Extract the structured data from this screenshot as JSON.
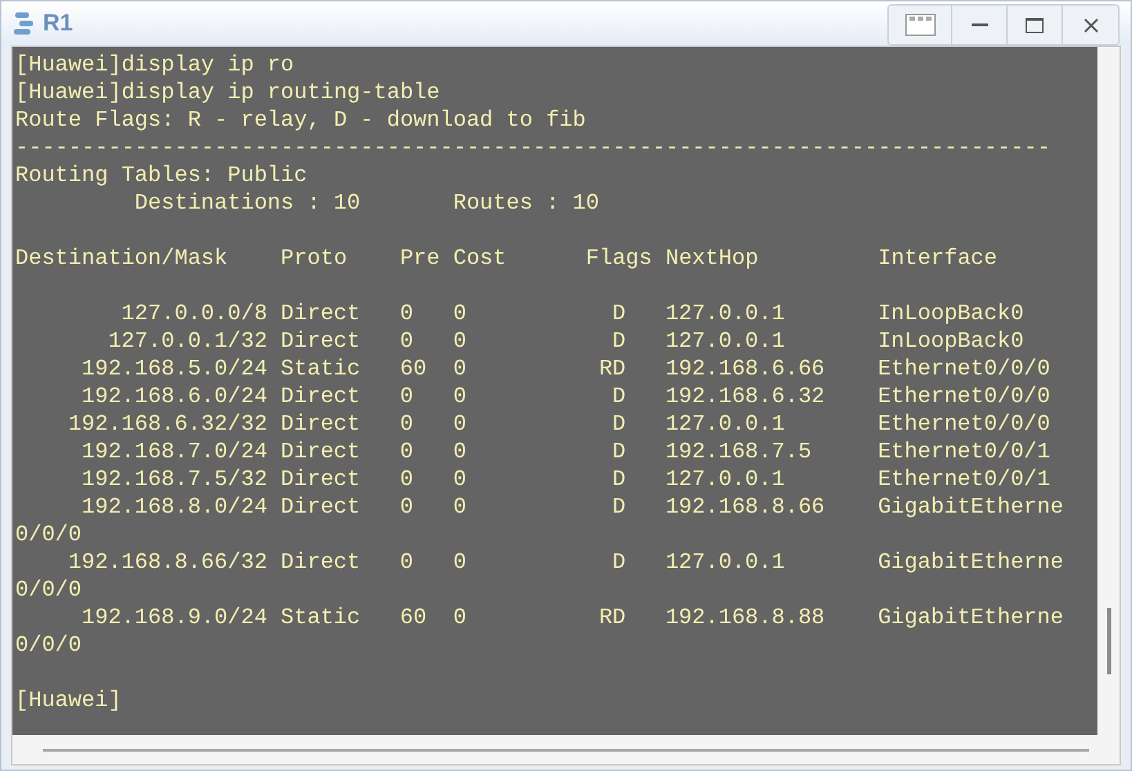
{
  "window": {
    "title": "R1"
  },
  "terminal": {
    "lines_before": [
      "[Huawei]display ip ro",
      "[Huawei]display ip routing-table",
      "Route Flags: R - relay, D - download to fib"
    ],
    "separator": "------------------------------------------------------------------------------",
    "table_title": "Routing Tables: Public",
    "summary": [
      "Destinations : 10",
      "Routes : 10"
    ],
    "columns": [
      "Destination/Mask",
      "Proto",
      "Pre",
      "Cost",
      "Flags",
      "NextHop",
      "Interface"
    ],
    "routes": [
      {
        "destination": "127.0.0.0/8",
        "proto": "Direct",
        "pre": "0",
        "cost": "0",
        "flags": "D",
        "nexthop": "127.0.0.1",
        "interface": "InLoopBack0"
      },
      {
        "destination": "127.0.0.1/32",
        "proto": "Direct",
        "pre": "0",
        "cost": "0",
        "flags": "D",
        "nexthop": "127.0.0.1",
        "interface": "InLoopBack0"
      },
      {
        "destination": "192.168.5.0/24",
        "proto": "Static",
        "pre": "60",
        "cost": "0",
        "flags": "RD",
        "nexthop": "192.168.6.66",
        "interface": "Ethernet0/0/0"
      },
      {
        "destination": "192.168.6.0/24",
        "proto": "Direct",
        "pre": "0",
        "cost": "0",
        "flags": "D",
        "nexthop": "192.168.6.32",
        "interface": "Ethernet0/0/0"
      },
      {
        "destination": "192.168.6.32/32",
        "proto": "Direct",
        "pre": "0",
        "cost": "0",
        "flags": "D",
        "nexthop": "127.0.0.1",
        "interface": "Ethernet0/0/0"
      },
      {
        "destination": "192.168.7.0/24",
        "proto": "Direct",
        "pre": "0",
        "cost": "0",
        "flags": "D",
        "nexthop": "192.168.7.5",
        "interface": "Ethernet0/0/1"
      },
      {
        "destination": "192.168.7.5/32",
        "proto": "Direct",
        "pre": "0",
        "cost": "0",
        "flags": "D",
        "nexthop": "127.0.0.1",
        "interface": "Ethernet0/0/1"
      },
      {
        "destination": "192.168.8.0/24",
        "proto": "Direct",
        "pre": "0",
        "cost": "0",
        "flags": "D",
        "nexthop": "192.168.8.66",
        "interface": "GigabitEtherne",
        "wrapped": "0/0/0"
      },
      {
        "destination": "192.168.8.66/32",
        "proto": "Direct",
        "pre": "0",
        "cost": "0",
        "flags": "D",
        "nexthop": "127.0.0.1",
        "interface": "GigabitEtherne",
        "wrapped": "0/0/0"
      },
      {
        "destination": "192.168.9.0/24",
        "proto": "Static",
        "pre": "60",
        "cost": "0",
        "flags": "RD",
        "nexthop": "192.168.8.88",
        "interface": "GigabitEtherne",
        "wrapped": "0/0/0"
      }
    ],
    "prompt": "[Huawei]"
  }
}
